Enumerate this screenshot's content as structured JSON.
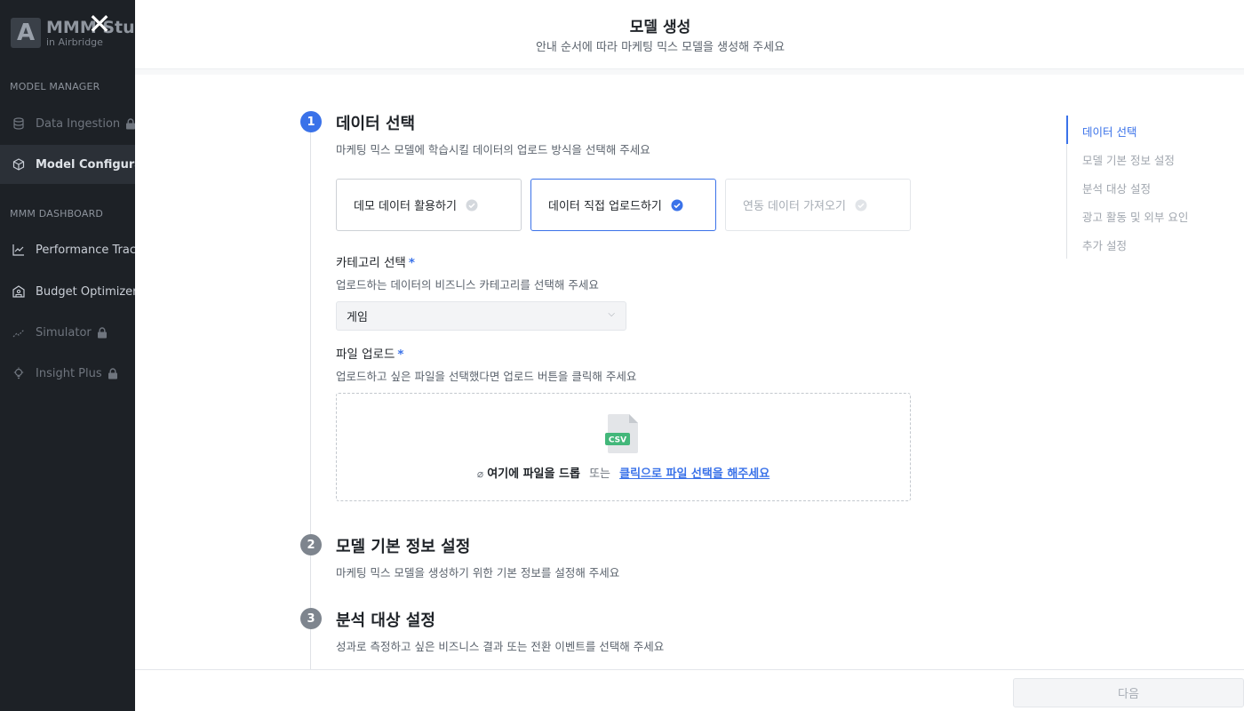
{
  "sidebar": {
    "logo_letter": "A",
    "logo_title": "MMM Studio",
    "logo_sub": "in Airbridge",
    "close_glyph": "✕",
    "sections": [
      {
        "label": "MODEL MANAGER"
      },
      {
        "label": "MMM DASHBOARD"
      }
    ],
    "items": [
      {
        "label": "Data Ingestion",
        "icon": "database-icon",
        "locked": true
      },
      {
        "label": "Model Configuration",
        "icon": "cube-icon",
        "active": true
      },
      {
        "label": "Performance Tracker",
        "icon": "chart-line-icon"
      },
      {
        "label": "Budget Optimizer",
        "icon": "bank-icon"
      },
      {
        "label": "Simulator",
        "icon": "trend-icon",
        "locked": true
      },
      {
        "label": "Insight Plus",
        "icon": "lightbulb-icon",
        "locked": true
      }
    ]
  },
  "modal": {
    "title": "모델 생성",
    "subtitle": "안내 순서에 따라 마케팅 믹스 모델을 생성해 주세요",
    "steps": [
      {
        "number": "1",
        "title": "데이터 선택",
        "description": "마케팅 믹스 모델에 학습시킬 데이터의 업로드 방식을 선택해 주세요"
      },
      {
        "number": "2",
        "title": "모델 기본 정보 설정",
        "description": "마케팅 믹스 모델을 생성하기 위한 기본 정보를 설정해 주세요"
      },
      {
        "number": "3",
        "title": "분석 대상 설정",
        "description": "성과로 측정하고 싶은 비즈니스 결과 또는 전환 이벤트를 선택해 주세요"
      }
    ],
    "data_options": [
      {
        "label": "데모 데이터 활용하기",
        "state": "default"
      },
      {
        "label": "데이터 직접 업로드하기",
        "state": "selected"
      },
      {
        "label": "연동 데이터 가져오기",
        "state": "disabled"
      }
    ],
    "category": {
      "label": "카테고리 선택",
      "required_mark": "*",
      "description": "업로드하는 데이터의 비즈니스 카테고리를 선택해 주세요",
      "selected_value": "게임"
    },
    "file_upload": {
      "label": "파일 업로드",
      "required_mark": "*",
      "description": "업로드하고 싶은 파일을 선택했다면 업로드 버튼을 클릭해 주세요",
      "file_badge": "CSV",
      "drop_text": "여기에 파일을 드롭",
      "or_text": "또는",
      "link_text": "클릭으로 파일 선택을 해주세요"
    },
    "step_nav": [
      {
        "label": "데이터 선택",
        "active": true
      },
      {
        "label": "모델 기본 정보 설정"
      },
      {
        "label": "분석 대상 설정"
      },
      {
        "label": "광고 활동 및 외부 요인"
      },
      {
        "label": "추가 설정"
      }
    ],
    "footer": {
      "next_label": "다음"
    }
  },
  "colors": {
    "accent": "#3a72e9",
    "sidebar_bg": "#1d2126",
    "inactive_badge": "#7e858e"
  }
}
